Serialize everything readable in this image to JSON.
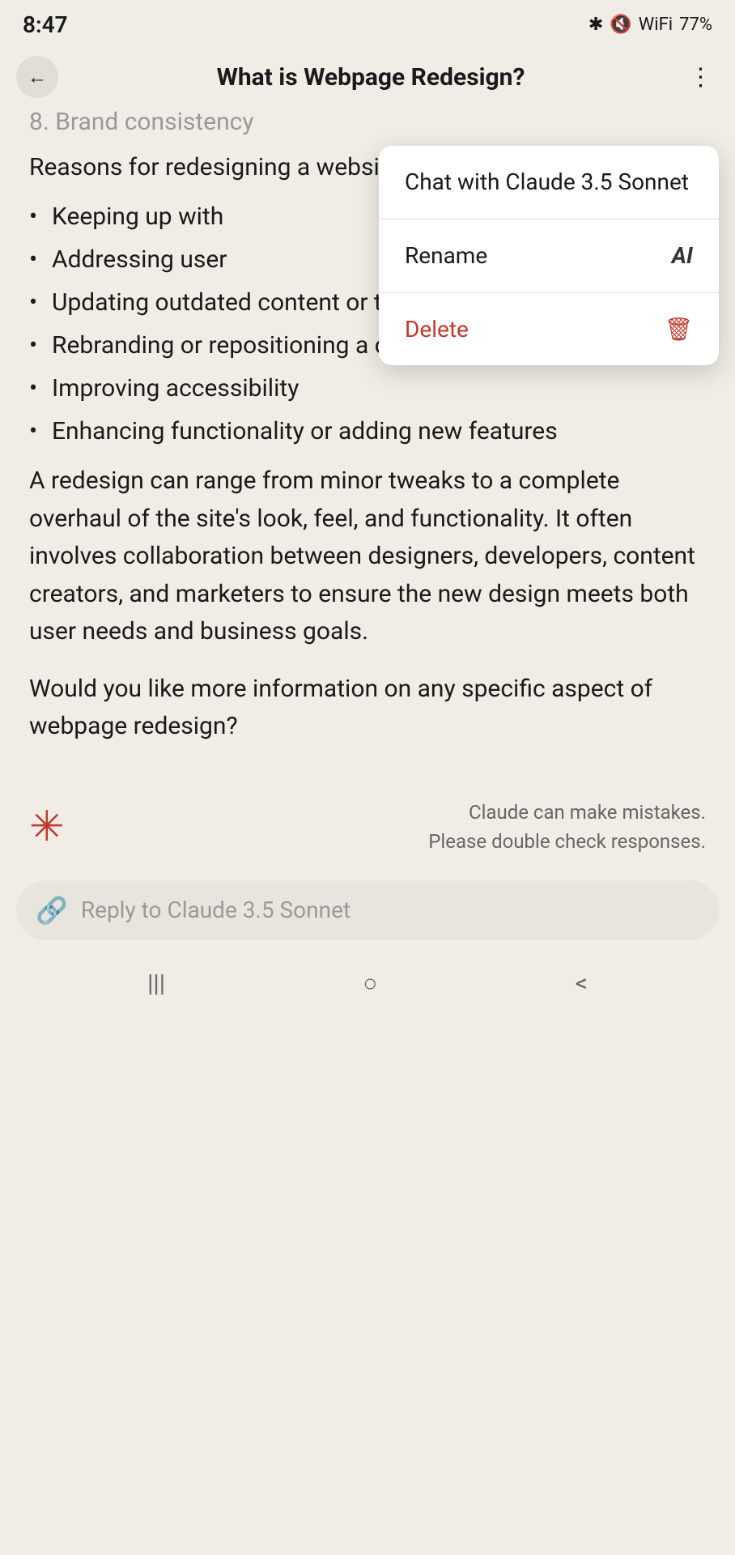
{
  "statusBar": {
    "time": "8:47",
    "batteryPercent": "77%"
  },
  "header": {
    "title": "What is Webpage Redesign?",
    "backLabel": "←",
    "moreLabel": "⋮"
  },
  "content": {
    "fadedHeading": "8. Brand consistency",
    "introText": "Reasons for redesigning a website include:",
    "bullets": [
      "Keeping up with",
      "Addressing user",
      "Updating outdated content or technology",
      "Rebranding or repositioning a company",
      "Improving accessibility",
      "Enhancing functionality or adding new features"
    ],
    "paragraph1": "A redesign can range from minor tweaks to a complete overhaul of the site's look, feel, and functionality. It often involves collaboration between designers, developers, content creators, and marketers to ensure the new design meets both user needs and business goals.",
    "paragraph2": "Would you like more information on any specific aspect of webpage redesign?"
  },
  "footer": {
    "disclaimer": "Claude can make mistakes.\nPlease double check responses."
  },
  "inputBar": {
    "placeholder": "Reply to Claude 3.5 Sonnet",
    "paperclipIcon": "📎"
  },
  "contextMenu": {
    "items": [
      {
        "label": "Chat with Claude 3.5 Sonnet",
        "icon": "",
        "iconLabel": "",
        "isDelete": false
      },
      {
        "label": "Rename",
        "icon": "AI",
        "iconLabel": "ai-icon",
        "isDelete": false
      },
      {
        "label": "Delete",
        "icon": "🗑",
        "iconLabel": "trash-icon",
        "isDelete": true
      }
    ]
  },
  "bottomNav": {
    "icons": [
      "|||",
      "○",
      "<"
    ]
  }
}
